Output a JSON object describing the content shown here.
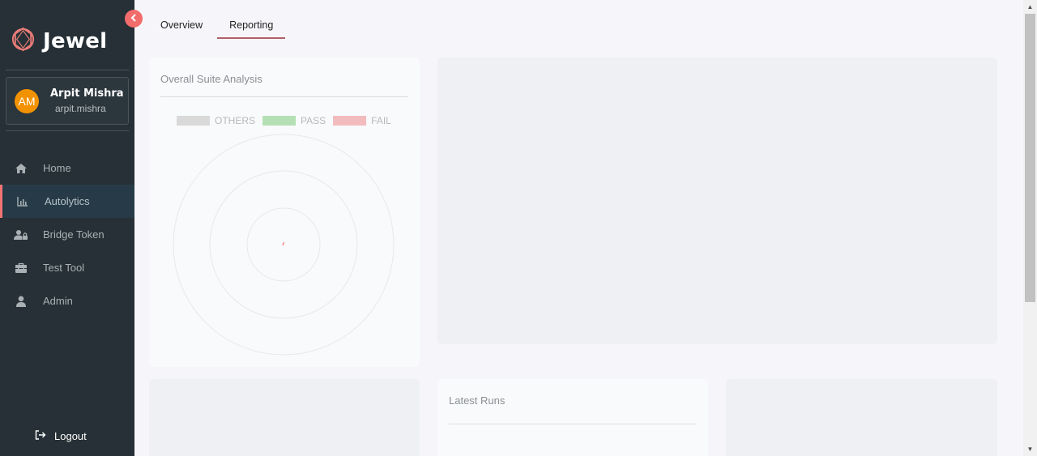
{
  "app": {
    "brand": "Jewel"
  },
  "user": {
    "initials": "AM",
    "name": "Arpit Mishra",
    "handle": "arpit.mishra"
  },
  "sidebar": {
    "items": [
      {
        "label": "Home",
        "icon": "home-icon"
      },
      {
        "label": "Autolytics",
        "icon": "bar-chart-icon",
        "active": true
      },
      {
        "label": "Bridge Token",
        "icon": "user-lock-icon"
      },
      {
        "label": "Test Tool",
        "icon": "toolbox-icon"
      },
      {
        "label": "Admin",
        "icon": "user-icon"
      }
    ],
    "logout_label": "Logout"
  },
  "tabs": [
    {
      "label": "Overview"
    },
    {
      "label": "Reporting",
      "active": true
    }
  ],
  "suite_analysis": {
    "title": "Overall Suite Analysis",
    "legend": [
      {
        "label": "OTHERS",
        "color": "#d9d9d9"
      },
      {
        "label": "PASS",
        "color": "#b5e0b5"
      },
      {
        "label": "FAIL",
        "color": "#f2bcbe"
      }
    ]
  },
  "latest_runs": {
    "title": "Latest Runs"
  },
  "colors": {
    "accent": "#f26c6c",
    "sidebar_bg": "#263036",
    "avatar": "#f39200"
  }
}
